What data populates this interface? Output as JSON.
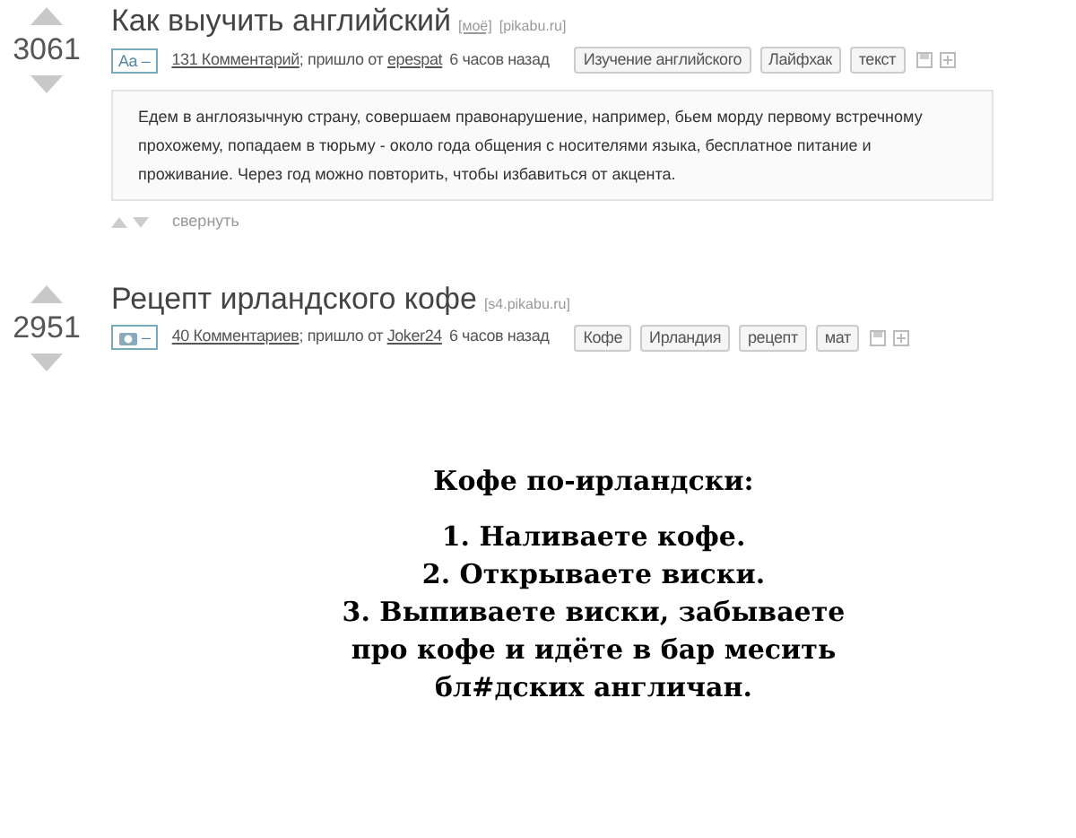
{
  "posts": [
    {
      "kind": "text",
      "score": "3061",
      "title": "Как выучить английский",
      "own_tag": "[моё]",
      "domain": "[pikabu.ru]",
      "badge": "Aa –",
      "comments": "131 Комментарий",
      "source_prefix": "; пришло от",
      "author": "epespat",
      "time": "6 часов назад",
      "tags": [
        "Изучение английского",
        "Лайфхак",
        "текст"
      ],
      "body": "Едем в англоязычную страну, совершаем правонарушение, например, бьем морду первому встречному прохожему, попадаем в тюрьму - около года общения с носителями языка, бесплатное питание и проживание. Через год можно повторить, чтобы избавиться от акцента.",
      "collapse": "свернуть"
    },
    {
      "kind": "image",
      "score": "2951",
      "title": "Рецепт ирландского кофе",
      "domain": "[s4.pikabu.ru]",
      "badge": "–",
      "comments": "40 Комментариев",
      "source_prefix": "; пришло от",
      "author": "Joker24",
      "time": "6 часов назад",
      "tags": [
        "Кофе",
        "Ирландия",
        "рецепт",
        "мат"
      ],
      "image_lines": [
        "Кофе по-ирландски:",
        "1. Наливаете кофе.",
        "2. Открываете виски.",
        "3. Выпиваете виски, забываете",
        "про кофе и идёте в бар месить",
        "бл#дских англичан."
      ]
    }
  ]
}
